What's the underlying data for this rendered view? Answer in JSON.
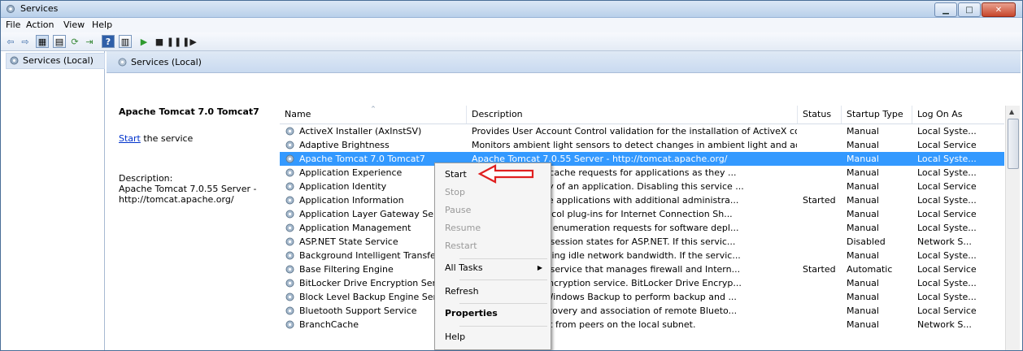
{
  "window": {
    "title": "Services",
    "icon": "gear-icon"
  },
  "menubar": {
    "items": [
      "File",
      "Action",
      "View",
      "Help"
    ]
  },
  "tree": {
    "item": "Services (Local)"
  },
  "main_header": {
    "title": "Services (Local)"
  },
  "details": {
    "name": "Apache Tomcat 7.0 Tomcat7",
    "start_link": "Start",
    "start_suffix": " the service",
    "description_label": "Description:",
    "description_line1": "Apache Tomcat 7.0.55 Server -",
    "description_line2": "http://tomcat.apache.org/"
  },
  "columns": [
    "Name",
    "Description",
    "Status",
    "Startup Type",
    "Log On As"
  ],
  "rows": [
    [
      "ActiveX Installer (AxInstSV)",
      "Provides User Account Control validation for the installation of ActiveX con...",
      "",
      "Manual",
      "Local Syste..."
    ],
    [
      "Adaptive Brightness",
      "Monitors ambient light sensors to detect changes in ambient light and adju...",
      "",
      "Manual",
      "Local Service"
    ],
    [
      "Apache Tomcat 7.0 Tomcat7",
      "Apache Tomcat 7.0.55 Server - http://tomcat.apache.org/",
      "",
      "Manual",
      "Local Syste..."
    ],
    [
      "Application Experience",
      "ion compatibility cache requests for applications as they ...",
      "",
      "Manual",
      "Local Syste..."
    ],
    [
      "Application Identity",
      "erifies the identity of an application. Disabling this service ...",
      "",
      "Manual",
      "Local Service"
    ],
    [
      "Application Information",
      "ning of interactive applications with additional administra...",
      "Started",
      "Manual",
      "Local Syste..."
    ],
    [
      "Application Layer Gateway Servi",
      "or 3rd party protocol plug-ins for Internet Connection Sh...",
      "",
      "Manual",
      "Local Service"
    ],
    [
      "Application Management",
      "ion, removal, and enumeration requests for software depl...",
      "",
      "Manual",
      "Local Syste..."
    ],
    [
      "ASP.NET State Service",
      "or out-of-process session states for ASP.NET. If this servic...",
      "",
      "Disabled",
      "Network S..."
    ],
    [
      "Background Intelligent Transfer",
      "he background using idle network bandwidth. If the servic...",
      "",
      "Manual",
      "Local Syste..."
    ],
    [
      "Base Filtering Engine",
      "Engine (BFE) is a service that manages firewall and Intern...",
      "Started",
      "Automatic",
      "Local Service"
    ],
    [
      "BitLocker Drive Encryption Servi",
      "BitLocker Drive Encryption service. BitLocker Drive Encryp...",
      "",
      "Manual",
      "Local Syste..."
    ],
    [
      "Block Level Backup Engine Servi",
      "rvice is used by Windows Backup to perform backup and ...",
      "",
      "Manual",
      "Local Syste..."
    ],
    [
      "Bluetooth Support Service",
      "vice supports discovery and association of remote Blueto...",
      "",
      "Manual",
      "Local Service"
    ],
    [
      "BranchCache",
      "s network content from peers on the local subnet.",
      "",
      "Manual",
      "Network S..."
    ]
  ],
  "selected_row": 2,
  "context_menu": {
    "start": "Start",
    "stop": "Stop",
    "pause": "Pause",
    "resume": "Resume",
    "restart": "Restart",
    "all_tasks": "All Tasks",
    "refresh": "Refresh",
    "properties": "Properties",
    "help": "Help"
  },
  "colors": {
    "selection": "#3399ff",
    "annotation_arrow": "#e02020"
  }
}
